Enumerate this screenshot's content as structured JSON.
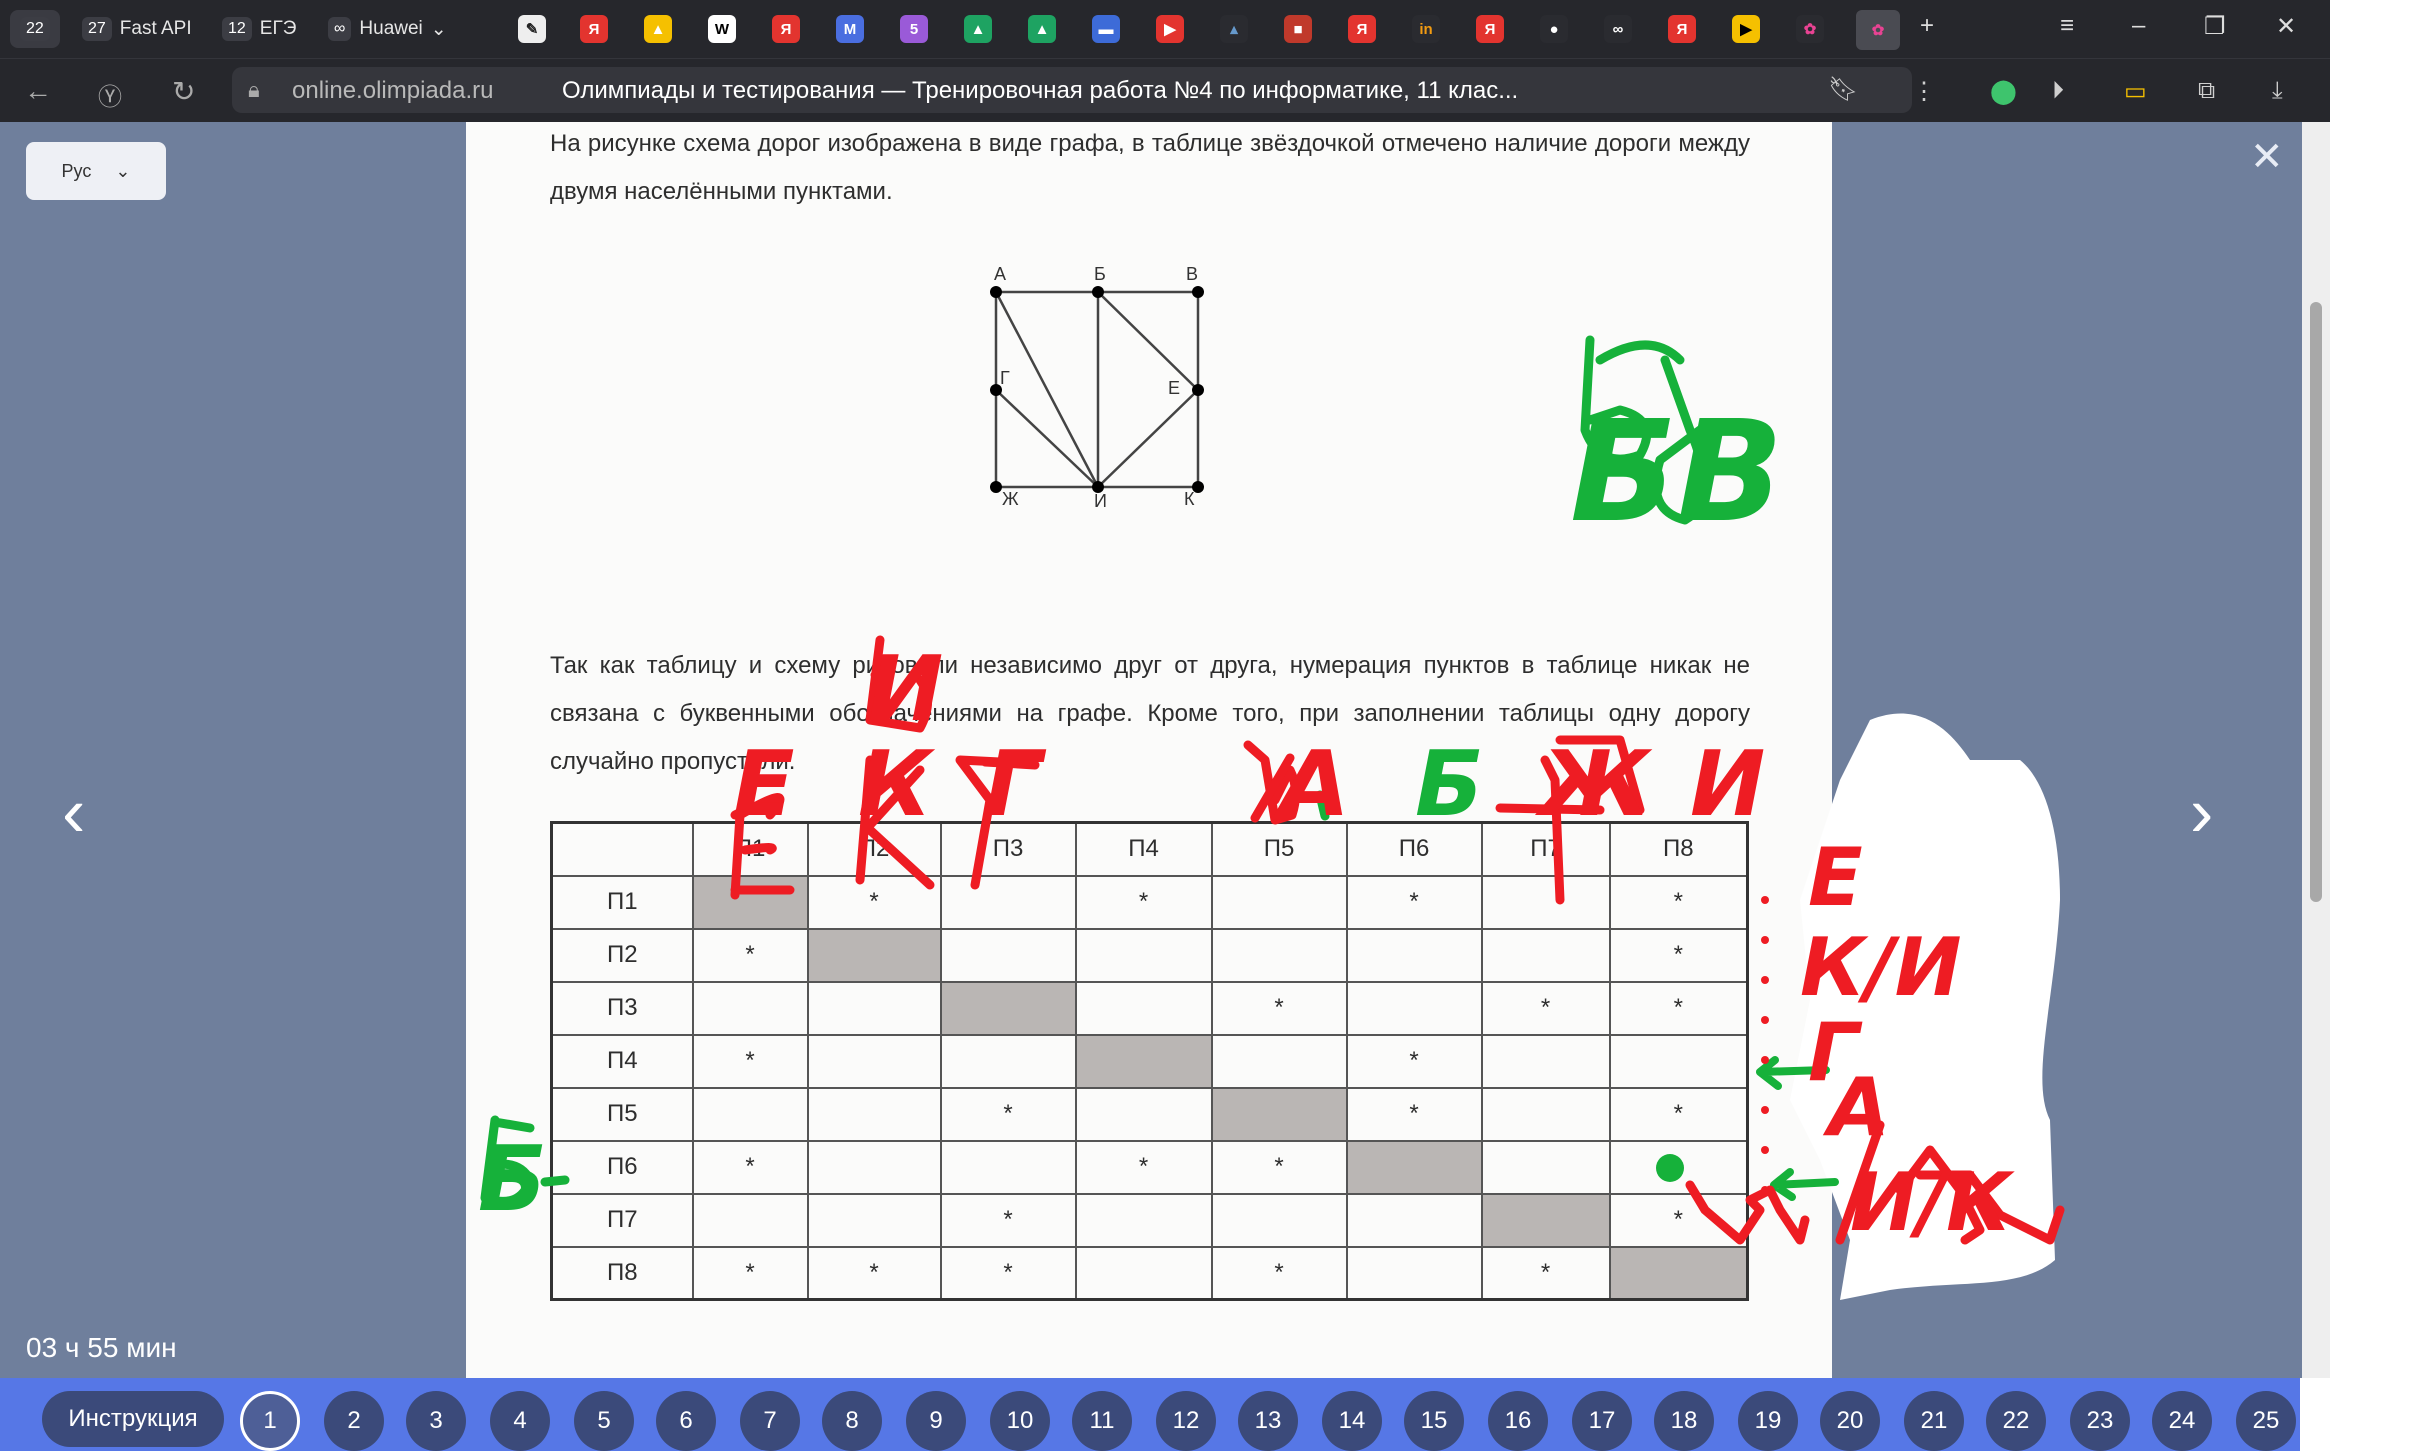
{
  "tabs": [
    {
      "count": "22",
      "label": ""
    },
    {
      "count": "27",
      "label": "Fast API"
    },
    {
      "count": "12",
      "label": "ЕГЭ"
    },
    {
      "count": "∞",
      "label": "Huawei"
    }
  ],
  "address": {
    "url": "online.olimpiada.ru",
    "title": "Олимпиады и тестирования — Тренировочная работа №4 по информатике, 11 клас..."
  },
  "lang": {
    "label": "Рус"
  },
  "task": {
    "para1": "На рисунке схема дорог изображена в виде графа, в таблице звёздочкой отмечено наличие дороги между двумя населёнными пунктами.",
    "para2": "Так как таблицу и схему рисовали независимо друг от друга, нумерация пунктов в таблице никак не связана с буквенными обозначениями на графе. Кроме того, при заполнении таблицы одну дорогу случайно пропустили."
  },
  "graph": {
    "nodes": {
      "A": "А",
      "B": "Б",
      "V": "В",
      "G": "Г",
      "E": "Е",
      "Zh": "Ж",
      "I": "И",
      "K": "К"
    }
  },
  "table": {
    "headers": [
      "П1",
      "П2",
      "П3",
      "П4",
      "П5",
      "П6",
      "П7",
      "П8"
    ],
    "cells": [
      [
        "#",
        "*",
        "",
        "*",
        "",
        "*",
        "",
        "*"
      ],
      [
        "*",
        "#",
        "",
        "",
        "",
        "",
        "",
        "*"
      ],
      [
        "",
        "",
        "#",
        "",
        "*",
        "",
        "*",
        "*"
      ],
      [
        "*",
        "",
        "",
        "#",
        "",
        "*",
        "",
        ""
      ],
      [
        "",
        "",
        "*",
        "",
        "#",
        "*",
        "",
        "*"
      ],
      [
        "*",
        "",
        "",
        "*",
        "*",
        "#",
        "",
        ""
      ],
      [
        "",
        "",
        "*",
        "",
        "",
        "",
        "#",
        "*"
      ],
      [
        "*",
        "*",
        "*",
        "",
        "*",
        "",
        "*",
        "#"
      ]
    ]
  },
  "timer": "03 ч 55 мин",
  "questions": {
    "instruction_label": "Инструкция",
    "numbers": [
      "1",
      "2",
      "3",
      "4",
      "5",
      "6",
      "7",
      "8",
      "9",
      "10",
      "11",
      "12",
      "13",
      "14",
      "15",
      "16",
      "17",
      "18",
      "19",
      "20",
      "21",
      "22",
      "23",
      "24",
      "25"
    ],
    "active": "1"
  },
  "annotations": {
    "col_letters": [
      "Е",
      "К",
      "Г",
      "А",
      "Б",
      "Ж",
      "И"
    ],
    "col_over": "И",
    "right_list": [
      "Е",
      "К/И",
      "Г",
      "А",
      "И/К"
    ],
    "left_mark": "Б",
    "top_right": "БВ"
  },
  "colors": {
    "red_ink": "#ee1c23",
    "green_ink": "#16b13a",
    "page_bg": "#6f7f9c",
    "question_bar": "#5677e6"
  }
}
